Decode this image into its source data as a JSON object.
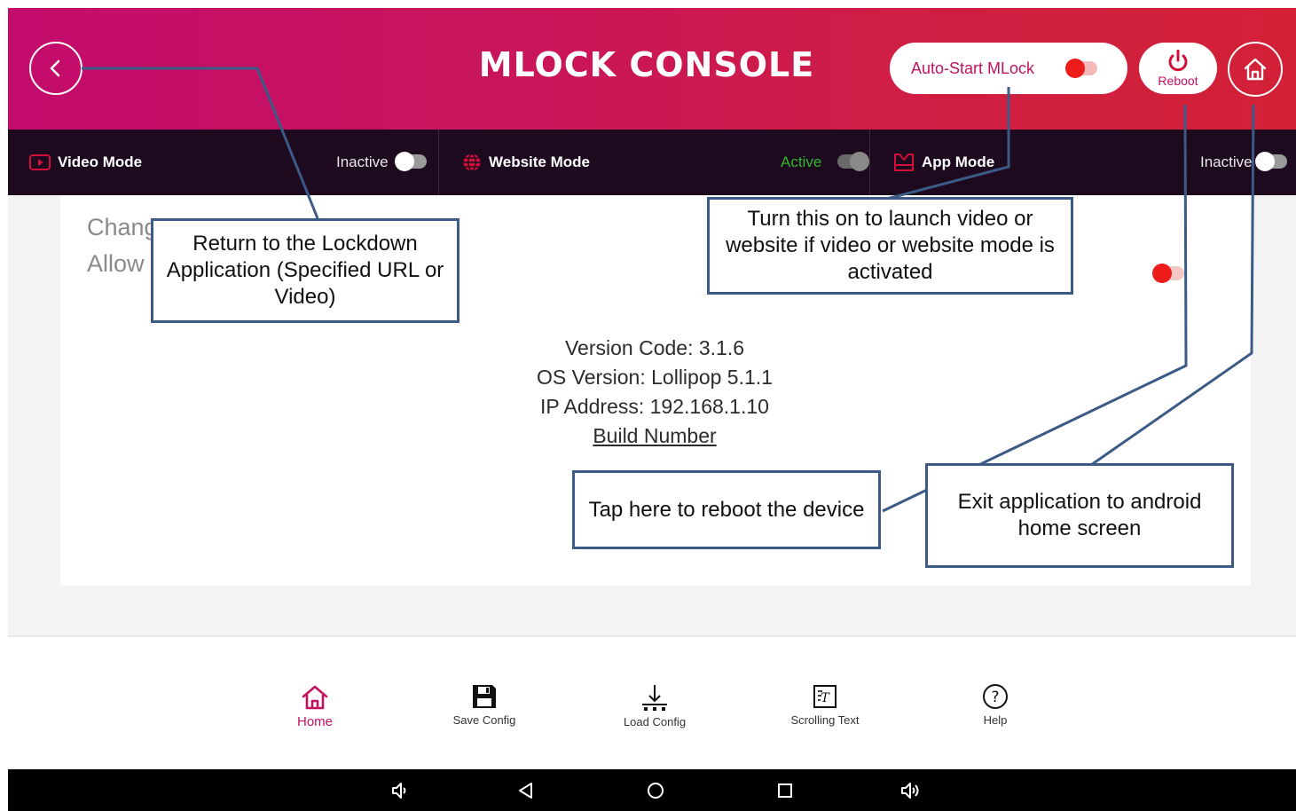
{
  "header": {
    "title": "MLOCK CONSOLE",
    "autostart_label": "Auto-Start MLock",
    "reboot_label": "Reboot"
  },
  "modes": [
    {
      "name": "Video Mode",
      "status": "Inactive",
      "icon": "video-icon"
    },
    {
      "name": "Website Mode",
      "status": "Active",
      "icon": "globe-icon"
    },
    {
      "name": "App Mode",
      "status": "Inactive",
      "icon": "app-icon"
    }
  ],
  "content": {
    "change_line1": "Chang",
    "change_line2": "Allow",
    "version_code": "Version Code: 3.1.6",
    "os_version": "OS Version: Lollipop 5.1.1",
    "ip_address": "IP Address: 192.168.1.10",
    "build_number": "Build Number"
  },
  "bottom_nav": [
    {
      "label": "Home",
      "icon": "home-icon",
      "active": true
    },
    {
      "label": "Save Config",
      "icon": "save-icon",
      "active": false
    },
    {
      "label": "Load Config",
      "icon": "download-icon",
      "active": false
    },
    {
      "label": "Scrolling Text",
      "icon": "text-icon",
      "active": false
    },
    {
      "label": "Help",
      "icon": "help-icon",
      "active": false
    }
  ],
  "annotations": {
    "back": "Return to the Lockdown Application (Specified URL or Video)",
    "autostart": "Turn this on to launch video or website if video or website mode is activated",
    "reboot": "Tap here to reboot the device",
    "exit": "Exit application to android home screen"
  },
  "colors": {
    "brand": "#c3125f",
    "header_start": "#c30c6c",
    "header_end": "#d22136",
    "modebar": "#1d0a1f",
    "active_green": "#2eb82e",
    "annotation_border": "#3c5a86"
  }
}
